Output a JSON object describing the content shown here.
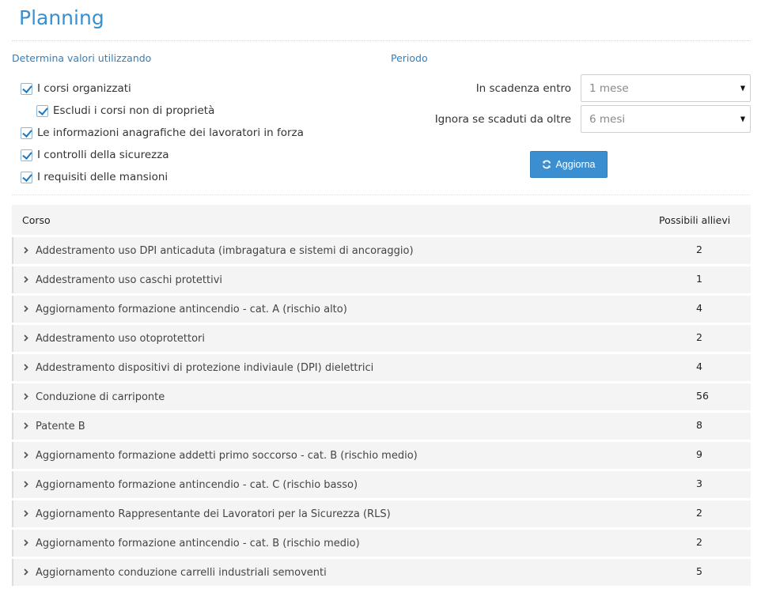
{
  "page": {
    "title": "Planning"
  },
  "filters": {
    "heading": "Determina valori utilizzando",
    "options": [
      {
        "label": "I corsi organizzati",
        "checked": true
      },
      {
        "label": "Escludi i corsi non di proprietà",
        "checked": true
      },
      {
        "label": "Le informazioni anagrafiche dei lavoratori in forza",
        "checked": true
      },
      {
        "label": "I controlli della sicurezza",
        "checked": true
      },
      {
        "label": "I requisiti delle mansioni",
        "checked": true
      }
    ]
  },
  "period": {
    "heading": "Periodo",
    "due_within_label": "In scadenza entro",
    "due_within_value": "1 mese",
    "ignore_label": "Ignora se scaduti da oltre",
    "ignore_value": "6 mesi",
    "refresh_label": "Aggiorna"
  },
  "table": {
    "columns": {
      "course": "Corso",
      "count": "Possibili allievi"
    },
    "rows": [
      {
        "name": "Addestramento uso DPI anticaduta (imbragatura e sistemi di ancoraggio)",
        "count": "2"
      },
      {
        "name": "Addestramento uso caschi protettivi",
        "count": "1"
      },
      {
        "name": "Aggiornamento formazione antincendio - cat. A (rischio alto)",
        "count": "4"
      },
      {
        "name": "Addestramento uso otoprotettori",
        "count": "2"
      },
      {
        "name": "Addestramento dispositivi di protezione indiviaule (DPI) dielettrici",
        "count": "4"
      },
      {
        "name": "Conduzione di carriponte",
        "count": "56"
      },
      {
        "name": "Patente B",
        "count": "8"
      },
      {
        "name": "Aggiornamento formazione addetti primo soccorso - cat. B (rischio medio)",
        "count": "9"
      },
      {
        "name": "Aggiornamento formazione antincendio - cat. C (rischio basso)",
        "count": "3"
      },
      {
        "name": "Aggiornamento Rappresentante dei Lavoratori per la Sicurezza (RLS)",
        "count": "2"
      },
      {
        "name": "Aggiornamento formazione antincendio - cat. B (rischio medio)",
        "count": "2"
      },
      {
        "name": "Aggiornamento conduzione carrelli industriali semoventi",
        "count": "5"
      }
    ]
  },
  "colors": {
    "accent": "#3a8fcf",
    "button": "#3b8fd1",
    "row_bg": "#f4f4f4"
  },
  "icons": {
    "checkbox": "checkmark-icon",
    "refresh": "refresh-icon",
    "expand": "chevron-right-icon",
    "dropdown": "caret-down-icon"
  }
}
